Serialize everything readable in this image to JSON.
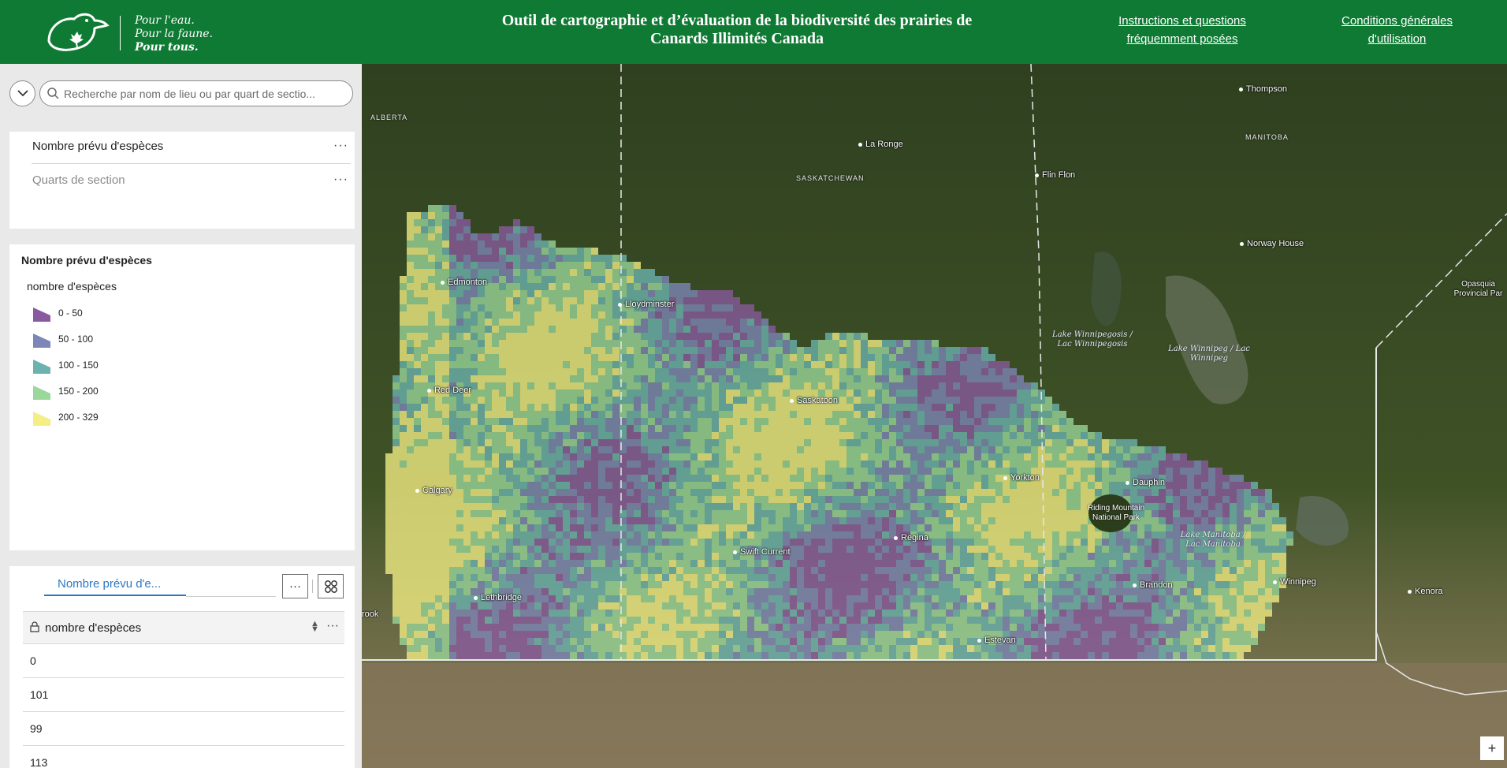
{
  "header": {
    "tagline": [
      "Pour l'eau.",
      "Pour la faune.",
      "Pour tous."
    ],
    "title_line1": "Outil de cartographie et d’évaluation de la biodiversité des prairies de",
    "title_line2": "Canards Illimités Canada",
    "link_faq_line1": "Instructions et questions",
    "link_faq_line2": "fréquemment posées",
    "link_terms_line1": "Conditions générales",
    "link_terms_line2": "d'utilisation"
  },
  "search": {
    "placeholder": "Recherche par nom de lieu ou par quart de sectio..."
  },
  "layers": [
    {
      "label": "Nombre prévu d'espèces"
    },
    {
      "label": "Quarts de section"
    }
  ],
  "legend": {
    "title": "Nombre prévu d'espèces",
    "field": "nombre d'espèces",
    "items": [
      {
        "label": "0 - 50",
        "color": "#8a5aa0"
      },
      {
        "label": "50 - 100",
        "color": "#7d86b8"
      },
      {
        "label": "100 - 150",
        "color": "#6cb3b0"
      },
      {
        "label": "150 - 200",
        "color": "#9ad79a"
      },
      {
        "label": "200 - 329",
        "color": "#f4ee84"
      }
    ]
  },
  "table": {
    "tab_label": "Nombre prévu d'e...",
    "column_header": "nombre d'espèces",
    "rows": [
      "0",
      "101",
      "99",
      "113"
    ]
  },
  "map": {
    "regions": [
      "ALBERTA",
      "SASKATCHEWAN",
      "MANITOBA"
    ],
    "cities": [
      "Thompson",
      "La Ronge",
      "Flin Flon",
      "Norway House",
      "Edmonton",
      "Lloydminster",
      "Red Deer",
      "Saskatoon",
      "Calgary",
      "Yorkton",
      "Dauphin",
      "Regina",
      "Swift Current",
      "Brandon",
      "Winnipeg",
      "Kenora",
      "Lethbridge",
      "Estevan"
    ],
    "lakes": [
      "Lake Winnipegosis / Lac Winnipegosis",
      "Lake Winnipeg / Lac Winnipeg",
      "Lake Manitoba / Lac Manitoba"
    ],
    "park": "Riding Mountain National Park",
    "edge_labels": [
      "Opasquia Provincial Par",
      "rook"
    ],
    "zoom_in": "+"
  }
}
